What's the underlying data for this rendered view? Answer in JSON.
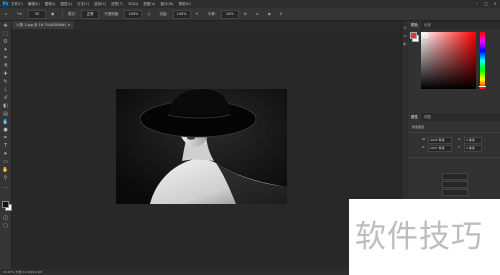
{
  "app": {
    "logo_text": "Ps",
    "menu": [
      "文件(F)",
      "编辑(E)",
      "图像(I)",
      "图层(L)",
      "文字(Y)",
      "选择(S)",
      "滤镜(T)",
      "3D(D)",
      "视图(V)",
      "窗口(W)",
      "帮助(H)"
    ]
  },
  "options_bar": {
    "size_value": "30",
    "mode_label": "模式:",
    "mode_value": "正常",
    "opacity_label": "不透明度:",
    "opacity_value": "100%",
    "flow_label": "流量:",
    "flow_value": "100%",
    "smooth_label": "平滑:",
    "smooth_value": "10%"
  },
  "document": {
    "tab_title": "人物 1.jpg @ 16.7%(RGB/8#) ×",
    "image_alt": "black and white portrait of a woman in a wide-brimmed hat"
  },
  "status": {
    "zoom_text": "16.67%    文档:24.9M/24.9M"
  },
  "panels": {
    "color_tabs": [
      "颜色",
      "色板"
    ],
    "properties_tabs": [
      "属性",
      "调整"
    ],
    "properties": {
      "section_label": "像素图层",
      "w_label": "W:",
      "w_value": "4000 像素",
      "h_label": "H:",
      "h_value": "2667 像素",
      "x_label": "X:",
      "x_value": "0 像素",
      "y_label": "Y:",
      "y_value": "0 像素",
      "footer_label": "背景"
    }
  },
  "watermark": {
    "text": "软件技巧"
  },
  "colors": {
    "foreground": "#e5323a",
    "background": "#ffffff",
    "accent": "#31a8ff"
  },
  "icons": {
    "tools": [
      "move-icon",
      "marquee-icon",
      "lasso-icon",
      "quick-select-icon",
      "crop-icon",
      "eyedropper-icon",
      "healing-icon",
      "brush-icon",
      "stamp-icon",
      "history-brush-icon",
      "eraser-icon",
      "gradient-icon",
      "blur-icon",
      "dodge-icon",
      "pen-icon",
      "type-icon",
      "path-select-icon",
      "shape-icon",
      "hand-icon",
      "zoom-icon"
    ]
  }
}
